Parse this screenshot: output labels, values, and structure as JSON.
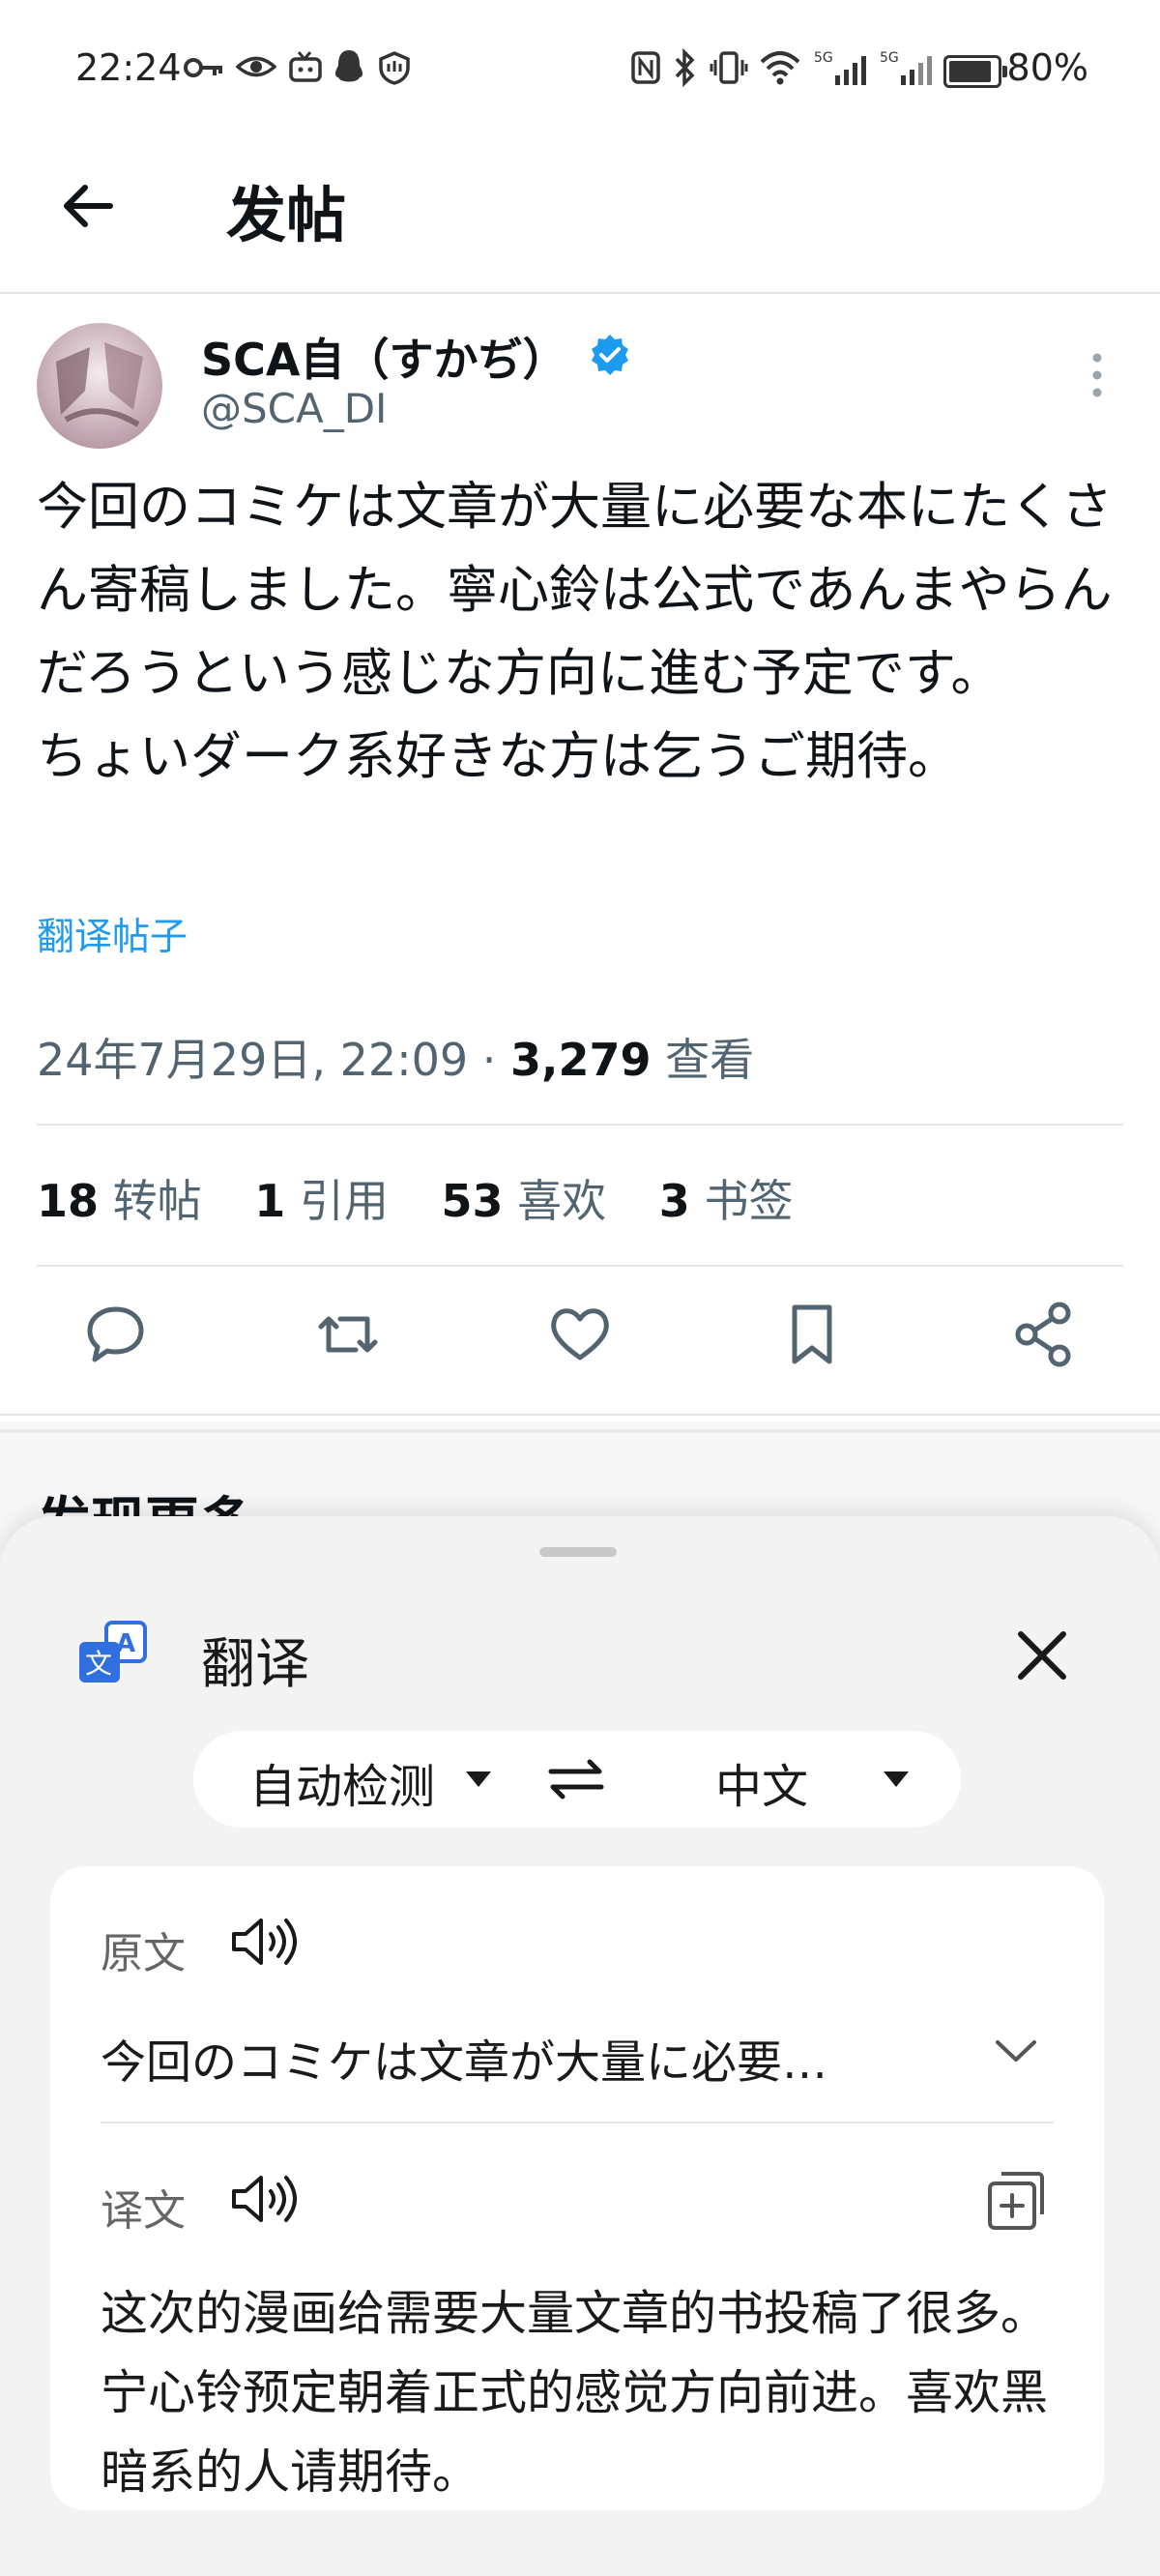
{
  "status_bar": {
    "time": "22:24",
    "battery": "80%",
    "icons": [
      "key-icon",
      "eye-icon",
      "tv-icon",
      "qq-icon",
      "shield-icon",
      "nfc-icon",
      "bluetooth-icon",
      "vibrate-icon",
      "wifi-icon",
      "signal-5g-icon",
      "signal-5g-icon",
      "battery-icon"
    ]
  },
  "header": {
    "title": "发帖"
  },
  "post": {
    "author_name": "SCA自（すかぢ）",
    "handle": "@SCA_DI",
    "text": "今回のコミケは文章が大量に必要な本にたくさん寄稿しました。寧心鈴は公式であんまやらんだろうという感じな方向に進む予定です。\nちょいダーク系好きな方は乞うご期待。",
    "translate_link": "翻译帖子",
    "timestamp": "24年7月29日, 22:09 · ",
    "views_count": "3,279",
    "views_label": " 查看",
    "stats": [
      {
        "count": "18",
        "label": "转帖"
      },
      {
        "count": "1",
        "label": "引用"
      },
      {
        "count": "53",
        "label": "喜欢"
      },
      {
        "count": "3",
        "label": "书签"
      }
    ]
  },
  "discover": {
    "title": "发现更多"
  },
  "translate_sheet": {
    "title": "翻译",
    "source_lang": "自动检测",
    "target_lang": "中文",
    "source_label": "原文",
    "source_text": "今回のコミケは文章が大量に必要…",
    "target_label": "译文",
    "target_text": "这次的漫画给需要大量文章的书投稿了很多。宁心铃预定朝着正式的感觉方向前进。喜欢黑暗系的人请期待。"
  },
  "colors": {
    "accent_blue": "#1d9bf0",
    "verified_blue": "#1d9bf0",
    "sheet_bg": "#f3f3f4",
    "translate_icon_blue": "#2f6fe0"
  }
}
